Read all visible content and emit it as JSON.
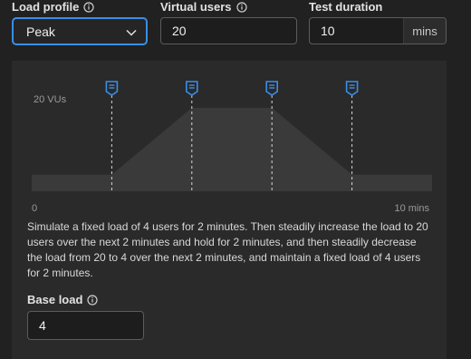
{
  "fields": {
    "load_profile": {
      "label": "Load profile",
      "value": "Peak"
    },
    "virtual_users": {
      "label": "Virtual users",
      "value": "20"
    },
    "test_duration": {
      "label": "Test duration",
      "value": "10",
      "unit": "mins"
    }
  },
  "chart": {
    "y_label": "20 VUs",
    "x_start_label": "0",
    "x_end_label": "10 mins",
    "fill_color": "#3a3a3a",
    "marker_color": "#3a8ee6"
  },
  "chart_data": {
    "type": "area",
    "x": [
      0,
      2,
      4,
      6,
      8,
      10
    ],
    "values": [
      4,
      4,
      20,
      20,
      4,
      4
    ],
    "markers": [
      2,
      4,
      6,
      8
    ],
    "xlabel": "",
    "ylabel": "",
    "xlim": [
      0,
      10
    ],
    "ylim": [
      0,
      20
    ],
    "tick_labels": {
      "y_max": "20 VUs",
      "x_min": "0",
      "x_max": "10 mins"
    }
  },
  "description": "Simulate a fixed load of 4 users for 2 minutes. Then steadily increase the load to 20 users over the next 2 minutes and hold for 2 minutes, and then steadily decrease the load from 20 to 4 over the next 2 minutes, and maintain a fixed load of 4 users for 2 minutes.",
  "base_load": {
    "label": "Base load",
    "value": "4"
  }
}
